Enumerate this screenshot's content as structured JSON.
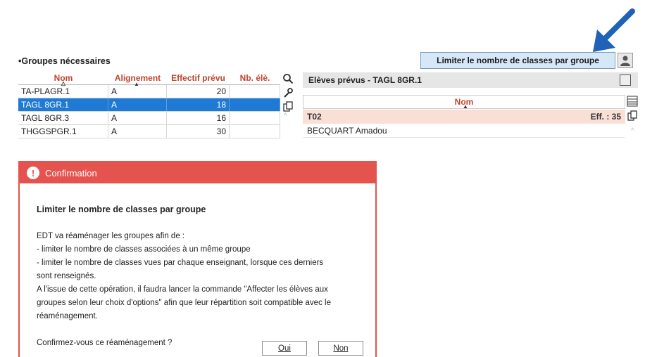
{
  "header": {
    "section_title": "•Groupes nécessaires",
    "limit_button": "Limiter le nombre de classes par groupe"
  },
  "left_table": {
    "columns": [
      "Nom",
      "Alignement",
      "Effectif prévu",
      "Nb. élè."
    ],
    "rows": [
      {
        "nom": "TA-PLAGR.1",
        "align": "A",
        "eff": "20",
        "nb": ""
      },
      {
        "nom": "TAGL 8GR.1",
        "align": "A",
        "eff": "18",
        "nb": ""
      },
      {
        "nom": "TAGL 8GR.3",
        "align": "A",
        "eff": "16",
        "nb": ""
      },
      {
        "nom": "THGGSPGR.1",
        "align": "A",
        "eff": "30",
        "nb": ""
      }
    ],
    "selected_index": 1
  },
  "right_panel": {
    "title": "Elèves prévus - TAGL 8GR.1",
    "column_header": "Nom",
    "group_row": {
      "name": "T02",
      "count": "Eff. : 35"
    },
    "students": [
      "BECQUART Amadou"
    ]
  },
  "dialog": {
    "title": "Confirmation",
    "heading": "Limiter le nombre de classes par groupe",
    "lines": [
      "EDT va réaménager les groupes afin de :",
      "- limiter le nombre de classes associées à un même groupe",
      "- limiter le nombre de classes vues par chaque enseignant, lorsque ces derniers",
      "sont renseignés.",
      "A l'issue de cette opération, il faudra lancer la commande \"Affecter les élèves aux",
      "groupes selon leur choix d'options\" afin que leur répartition soit compatible avec le",
      "réaménagement."
    ],
    "question": "Confirmez-vous ce réaménagement ?",
    "yes": "Oui",
    "no": "Non"
  },
  "colors": {
    "accent_red": "#e5534f",
    "selection_blue": "#1f7ad6",
    "header_red_text": "#c0442f",
    "arrow_blue": "#1f62b8"
  }
}
